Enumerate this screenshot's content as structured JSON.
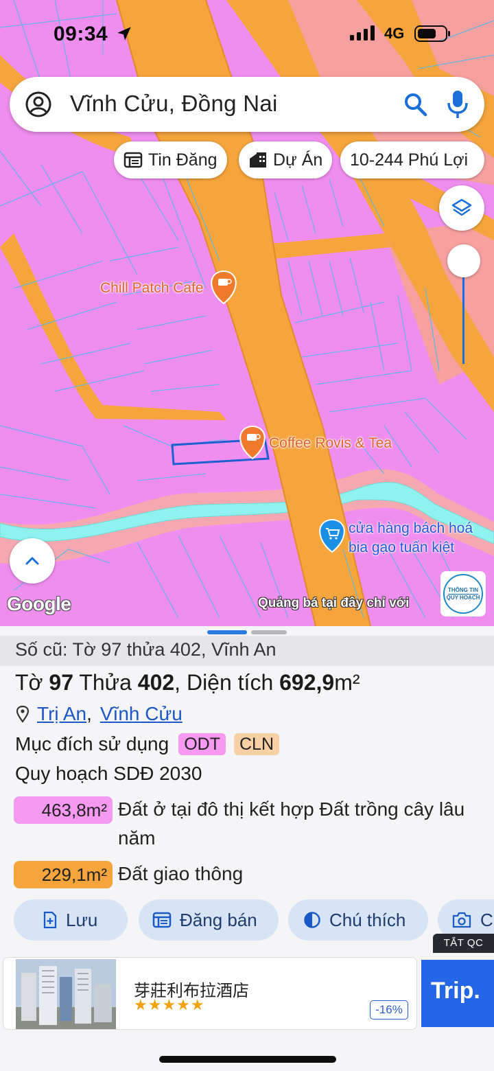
{
  "status_bar": {
    "time": "09:34",
    "network": "4G"
  },
  "search": {
    "value": "Vĩnh Cửu, Đồng Nai"
  },
  "chips": [
    {
      "label": "Tin Đăng",
      "icon": "listing-icon"
    },
    {
      "label": "Dự Án",
      "icon": "building-icon"
    },
    {
      "label": "10-244 Phú Lợi",
      "icon": ""
    }
  ],
  "map": {
    "pois": [
      {
        "name": "Chill Patch Cafe",
        "type": "cafe"
      },
      {
        "name": "Coffee Rovis & Tea",
        "type": "cafe"
      },
      {
        "name_line1": "cửa hàng bách hoá",
        "name_line2": "bia gạo tuấn kiệt",
        "type": "shop"
      }
    ],
    "attribution": "Google",
    "ad_text": "Quảng bá tại đây chỉ với",
    "badge_line1": "THÔNG TIN",
    "badge_line2": "QUY HOẠCH",
    "colors": {
      "residential": "#f08ef0",
      "road": "#f5a53c",
      "river": "#8ff2ef",
      "parcel_outline": "#1d5ed1"
    }
  },
  "sheet": {
    "old_ref": "Số cũ: Tờ 97 thửa 402, Vĩnh An",
    "title": {
      "pre": "Tờ ",
      "sheet_no": "97",
      "mid": " Thửa ",
      "parcel_no": "402",
      "sep": ", Diện tích ",
      "area": "692,9",
      "unit": "m²"
    },
    "location": {
      "commune": "Trị An",
      "separator": ",",
      "district": "Vĩnh Cửu"
    },
    "purpose_label": "Mục đích sử dụng",
    "tags": [
      {
        "code": "ODT",
        "color": "#f59af0"
      },
      {
        "code": "CLN",
        "color": "#f9d0a6"
      }
    ],
    "plan_label": "Quy hoạch SDĐ 2030",
    "areas": [
      {
        "value": "463,8m²",
        "desc": "Đất ở tại đô thị kết hợp Đất trồng cây lâu năm",
        "color": "#f59af0"
      },
      {
        "value": "229,1m²",
        "desc": "Đất giao thông",
        "color": "#f5a53c"
      }
    ],
    "actions": [
      {
        "label": "Lưu",
        "icon": "save-icon"
      },
      {
        "label": "Đăng bán",
        "icon": "post-listing-icon"
      },
      {
        "label": "Chú thích",
        "icon": "legend-icon"
      },
      {
        "label": "C",
        "icon": "camera-icon"
      }
    ],
    "hide_ads": "TẮT QC",
    "ad": {
      "title": "芽莊利布拉酒店",
      "stars": "★★★★★",
      "discount": "-16%",
      "brand": "Trip."
    }
  }
}
